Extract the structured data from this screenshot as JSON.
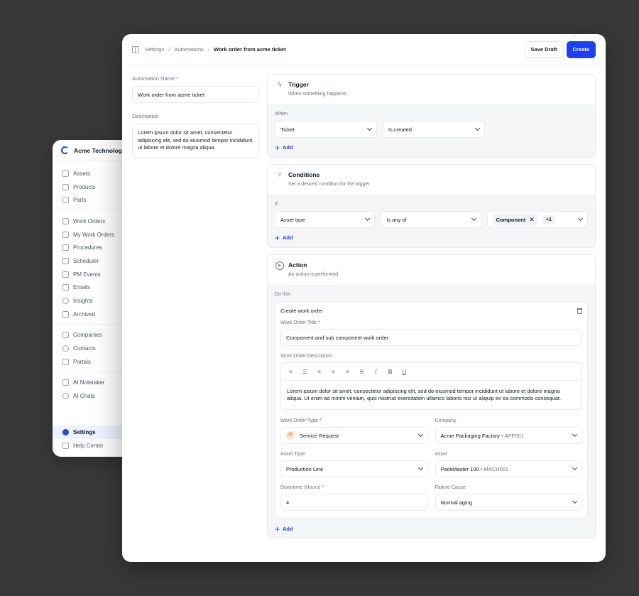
{
  "sidebar": {
    "org_name": "Acme Technologi...",
    "groups": [
      [
        "Assets",
        "Products",
        "Parts"
      ],
      [
        "Work Orders",
        "My Work Orders",
        "Procedures",
        "Scheduler",
        "PM Events",
        "Emails",
        "Insights",
        "Archived"
      ],
      [
        "Companies",
        "Contacts",
        "Portals"
      ],
      [
        "AI Notetaker",
        "AI Chats"
      ]
    ],
    "settings_label": "Settings",
    "help_label": "Help Center"
  },
  "header": {
    "breadcrumb": [
      "Settings",
      "Automations",
      "Work order from acme ticket"
    ],
    "save_draft_label": "Save Draft",
    "create_label": "Create"
  },
  "form": {
    "name_label": "Automation Name",
    "name_value": "Work order from acme ticket",
    "description_label": "Description",
    "description_value": "Lorem ipsum dolor sit amet, consectetur adipiscing elit, sed do eiusmod tempor incididunt ut labore et dolore magna aliqua."
  },
  "trigger": {
    "title": "Trigger",
    "subtitle": "When something happens",
    "when_label": "When",
    "entity": "Ticket",
    "event": "Is created",
    "add_label": "Add"
  },
  "conditions": {
    "title": "Conditions",
    "subtitle": "Set a desired condition for the trigger",
    "if_label": "If",
    "field": "Asset type",
    "operator": "Is any of",
    "chip": "Component",
    "more_count": "+1",
    "add_label": "Add"
  },
  "action": {
    "title": "Action",
    "subtitle": "An action is performed",
    "do_label": "Do this",
    "card_title": "Create work order",
    "wo_title_label": "Work Order Title",
    "wo_title_value": "Component and sub component work order",
    "wo_desc_label": "Work Order Description",
    "wo_desc_value": "Lorem ipsum dolor sit amet, consectetur adipiscing elit, sed do eiusmod tempor incididunt ut labore et dolore magna aliqua. Ut enim ad minim veniam, quis nostrud exercitation ullamco laboris nisi ut aliquip ex ea commodo consequat.",
    "wo_type_label": "Work Order Type",
    "wo_type_value": "Service Request",
    "company_label": "Company",
    "company_value": "Acme Packaging Factory",
    "company_code": "APF001",
    "asset_type_label": "Asset Type",
    "asset_type_value": "Production Line",
    "asset_label": "Asset",
    "asset_value": "PackMaster 100",
    "asset_code": "MACH001",
    "downtime_label": "Downtime (Hours)",
    "downtime_value": "4",
    "failure_label": "Failure Cause",
    "failure_value": "Normal aging",
    "add_label": "Add"
  },
  "colors": {
    "accent": "#1d3ff0",
    "background": "#383838",
    "required": "#ef4444"
  }
}
